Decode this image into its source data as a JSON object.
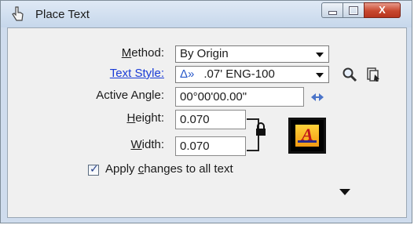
{
  "window": {
    "title": "Place Text",
    "close_glyph": "X"
  },
  "method": {
    "label_prefix": "M",
    "label_rest": "ethod:",
    "value": "By Origin"
  },
  "text_style": {
    "label": "Text Style:",
    "glyph": "Δ»",
    "value": ".07'  ENG-100"
  },
  "active_angle": {
    "label_prefix": "Active Angle:",
    "value": "00°00'00.00\""
  },
  "height": {
    "label_u": "H",
    "label_rest": "eight:",
    "value": "0.070"
  },
  "width": {
    "label_u": "W",
    "label_rest": "idth:",
    "value": "0.070"
  },
  "apply_changes": {
    "label_before": "Apply ",
    "label_u": "c",
    "label_after": "hanges to all text",
    "checked": true
  },
  "swatch": {
    "letter": "A",
    "colors": {
      "background": "#ffd23a",
      "letter": "#c0161a",
      "line": "#2c2a8a"
    }
  },
  "icons": {
    "app": "hand-pointer-icon",
    "search": "magnifier-icon",
    "match": "match-style-icon",
    "angle": "angle-step-icon",
    "lock": "lock-icon",
    "expand": "expand-arrow-icon"
  }
}
